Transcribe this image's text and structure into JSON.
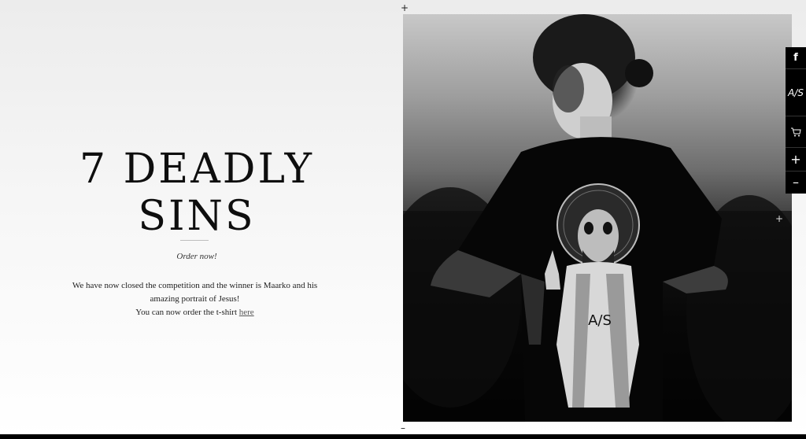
{
  "title": {
    "line1": "7 DEADLY",
    "line2": "SINS"
  },
  "order_link": "Order now!",
  "body": {
    "line1": "We have now closed the competition and the winner is Maarko and his amazing portrait of Jesus!",
    "line2_prefix": "You can now order the t-shirt",
    "line2_link": "here"
  },
  "marks": {
    "plus": "+",
    "minus": "–"
  },
  "toolbar": {
    "facebook": "f",
    "logo": "A/S",
    "cart_icon": "cart-icon",
    "plus": "+",
    "minus": "–"
  },
  "shirt_print": {
    "logo": "A/S"
  }
}
